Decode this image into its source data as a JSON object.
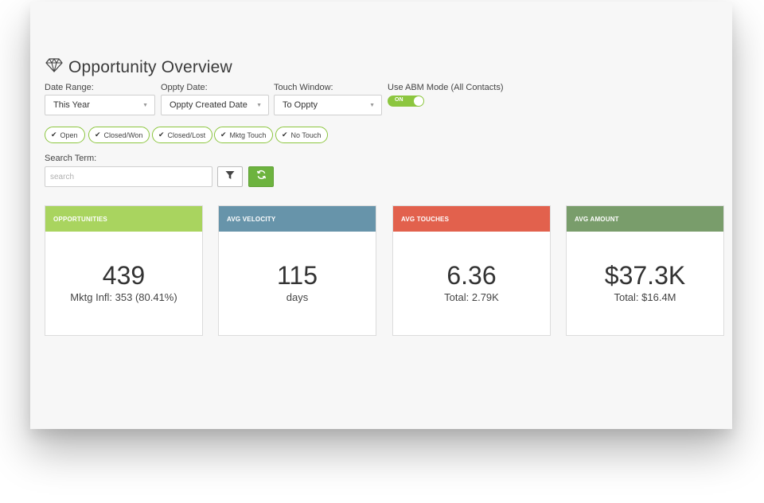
{
  "header": {
    "title": "Opportunity Overview",
    "icon": "diamond-icon"
  },
  "filters": {
    "date_range": {
      "label": "Date Range:",
      "value": "This Year"
    },
    "oppty_date": {
      "label": "Oppty Date:",
      "value": "Oppty Created Date"
    },
    "touch_window": {
      "label": "Touch Window:",
      "value": "To Oppty"
    },
    "abm_mode": {
      "label": "Use ABM Mode (All Contacts)",
      "state": "ON"
    }
  },
  "chips": [
    "Open",
    "Closed/Won",
    "Closed/Lost",
    "Mktg Touch",
    "No Touch"
  ],
  "search": {
    "label": "Search Term:",
    "placeholder": "search"
  },
  "cards": [
    {
      "title": "OPPORTUNITIES",
      "value": "439",
      "sub": "Mktg Infl: 353 (80.41%)",
      "color": "#a9d45f"
    },
    {
      "title": "AVG VELOCITY",
      "value": "115",
      "sub": "days",
      "color": "#6794aa"
    },
    {
      "title": "AVG TOUCHES",
      "value": "6.36",
      "sub": "Total: 2.79K",
      "color": "#e2614d"
    },
    {
      "title": "AVG AMOUNT",
      "value": "$37.3K",
      "sub": "Total: $16.4M",
      "color": "#799d6b"
    }
  ]
}
